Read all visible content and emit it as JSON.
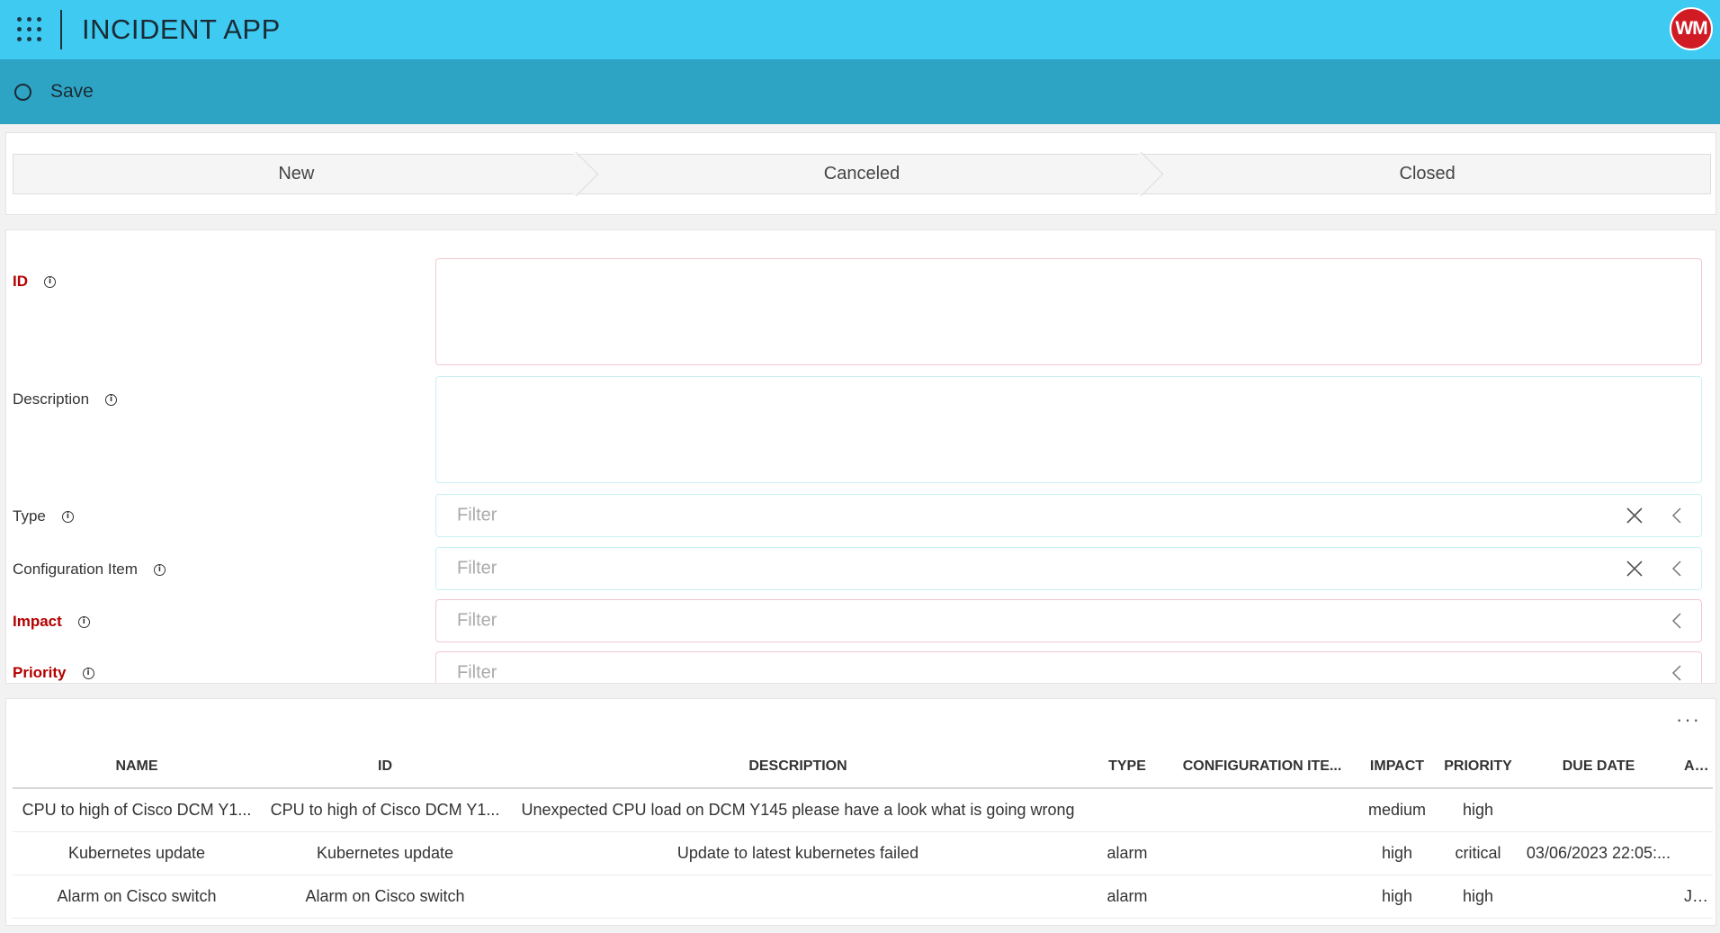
{
  "header": {
    "app_title": "INCIDENT APP",
    "avatar_initials": "WM",
    "colors": {
      "topbar": "#3ecaf1",
      "actionbar": "#2ea4c4",
      "avatar": "#d01b25",
      "required": "#b40000"
    }
  },
  "actions": {
    "save_label": "Save"
  },
  "status_steps": [
    "New",
    "Canceled",
    "Closed"
  ],
  "form": {
    "id_label": "ID",
    "description_label": "Description",
    "type_label": "Type",
    "type_placeholder": "Filter",
    "config_item_label": "Configuration Item",
    "config_item_placeholder": "Filter",
    "impact_label": "Impact",
    "impact_placeholder": "Filter",
    "priority_label": "Priority",
    "priority_placeholder": "Filter"
  },
  "table": {
    "more_label": "···",
    "columns": [
      "NAME",
      "ID",
      "DESCRIPTION",
      "TYPE",
      "CONFIGURATION ITE...",
      "IMPACT",
      "PRIORITY",
      "DUE DATE",
      "ASSIG"
    ],
    "rows": [
      {
        "name": "CPU to high of Cisco DCM Y1...",
        "id": "CPU to high of Cisco DCM Y1...",
        "description": "Unexpected CPU load on DCM Y145 please have a look what is going wrong",
        "type": "",
        "config": "",
        "impact": "medium",
        "priority": "high",
        "due": "",
        "assign": ""
      },
      {
        "name": "Kubernetes update",
        "id": "Kubernetes update",
        "description": "Update to latest kubernetes failed",
        "type": "alarm",
        "config": "",
        "impact": "high",
        "priority": "critical",
        "due": "03/06/2023 22:05:...",
        "assign": ""
      },
      {
        "name": "Alarm on Cisco switch",
        "id": "Alarm on Cisco switch",
        "description": "",
        "type": "alarm",
        "config": "",
        "impact": "high",
        "priority": "high",
        "due": "",
        "assign": "Joh"
      }
    ]
  }
}
